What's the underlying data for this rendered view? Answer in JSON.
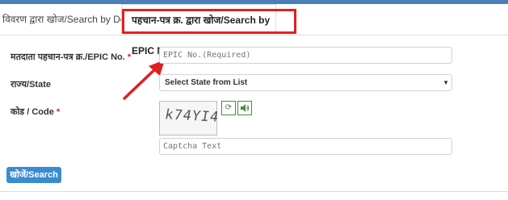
{
  "tabs": {
    "details_label": "विवरण द्वारा खोज/Search by Details",
    "epic_label": "पहचान-पत्र क्र. द्वारा खोज/Search by EPIC No."
  },
  "form": {
    "epic_label": "मतदाता पहचान-पत्र क्र./EPIC No.",
    "epic_required_mark": "*",
    "epic_placeholder": "EPIC No.(Required)",
    "state_label": "राज्य/State",
    "state_selected": "Select State from List",
    "code_label": "कोड / Code",
    "code_required_mark": "*",
    "captcha_text": "k74YI4",
    "captcha_placeholder": "Captcha Text",
    "submit_label": "खोजें/Search"
  },
  "icons": {
    "refresh": "refresh-icon",
    "audio": "speaker-icon",
    "dropdown": "caret-down-icon"
  },
  "colors": {
    "highlight": "#e02020",
    "arrow": "#e02020",
    "button": "#3b8bd1",
    "icon_border": "#4d8b3f",
    "required": "#d9232d"
  }
}
